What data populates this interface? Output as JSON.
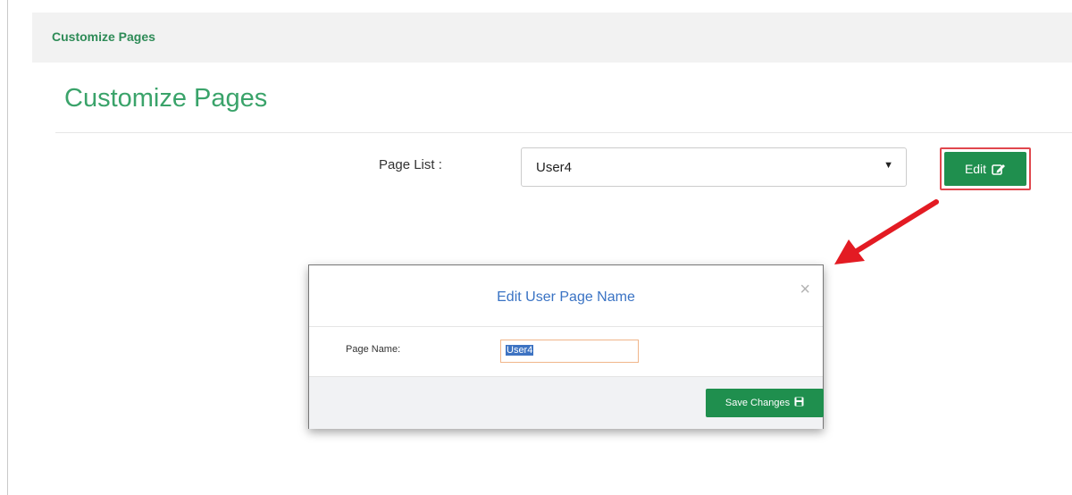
{
  "header": {
    "title": "Customize Pages"
  },
  "page": {
    "title": "Customize Pages"
  },
  "page_list": {
    "label": "Page List :",
    "selected": "User4"
  },
  "edit_button": {
    "label": "Edit"
  },
  "modal": {
    "title": "Edit User Page Name",
    "close_symbol": "×",
    "field_label": "Page Name:",
    "field_value": "User4",
    "save_label": "Save Changes"
  },
  "colors": {
    "accent_green": "#1f8f4e",
    "title_green": "#3aa36a",
    "modal_title_blue": "#3a73c4",
    "highlight_red": "#e0464d"
  },
  "icons": {
    "edit": "edit-square-icon",
    "save": "floppy-disk-icon",
    "caret": "chevron-down-icon"
  }
}
